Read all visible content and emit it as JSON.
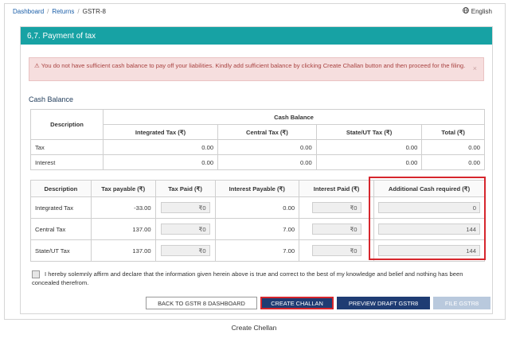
{
  "breadcrumb": {
    "items": [
      "Dashboard",
      "Returns",
      "GSTR-8"
    ]
  },
  "language": "English",
  "panel": {
    "title": "6,7. Payment of tax"
  },
  "alert": {
    "message": "You do not have sufficient cash balance to pay off your liabilities. Kindly add sufficient balance by clicking Create Challan button and then proceed for the filing.",
    "close": "×"
  },
  "cash_balance": {
    "section_title": "Cash Balance",
    "desc_header": "Description",
    "group_header": "Cash Balance",
    "columns": [
      "Integrated Tax (₹)",
      "Central Tax (₹)",
      "State/UT Tax (₹)",
      "Total (₹)"
    ],
    "rows": [
      {
        "label": "Tax",
        "values": [
          "0.00",
          "0.00",
          "0.00",
          "0.00"
        ]
      },
      {
        "label": "Interest",
        "values": [
          "0.00",
          "0.00",
          "0.00",
          "0.00"
        ]
      }
    ]
  },
  "payment_table": {
    "headers": [
      "Description",
      "Tax payable (₹)",
      "Tax Paid (₹)",
      "Interest Payable (₹)",
      "Interest Paid (₹)",
      "Additional Cash required (₹)"
    ],
    "rows": [
      {
        "label": "Integrated Tax",
        "tax_payable": "-33.00",
        "tax_paid": "₹0",
        "interest_payable": "0.00",
        "interest_paid": "₹0",
        "additional": "0"
      },
      {
        "label": "Central Tax",
        "tax_payable": "137.00",
        "tax_paid": "₹0",
        "interest_payable": "7.00",
        "interest_paid": "₹0",
        "additional": "144"
      },
      {
        "label": "State/UT Tax",
        "tax_payable": "137.00",
        "tax_paid": "₹0",
        "interest_payable": "7.00",
        "interest_paid": "₹0",
        "additional": "144"
      }
    ]
  },
  "declaration": "I hereby solemnly affirm and declare that the information given herein above is true and correct to the best of my knowledge and belief and nothing has been concealed therefrom.",
  "buttons": {
    "back": "BACK TO GSTR 8 DASHBOARD",
    "create": "CREATE CHALLAN",
    "preview": "PREVIEW DRAFT GSTR8",
    "file": "FILE GSTR8"
  },
  "caption": "Create Chellan",
  "colors": {
    "header": "#17a2a4",
    "primary_button": "#1f3c73",
    "highlight": "#d6262d",
    "alert_bg": "#f6dede"
  }
}
